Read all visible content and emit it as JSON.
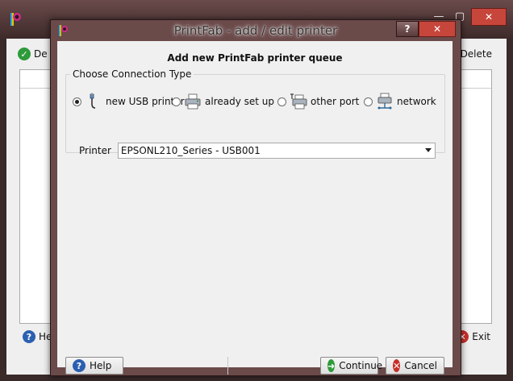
{
  "background_window": {
    "left_button_label": "De",
    "right_button_label": "Delete",
    "help_label": "He",
    "exit_label": "Exit",
    "close_glyph": "✕",
    "minimize_glyph": "—",
    "maximize_glyph": "▢"
  },
  "dialog": {
    "title": "PrintFab - add / edit printer",
    "help_glyph": "?",
    "close_glyph": "✕",
    "heading": "Add new PrintFab printer queue",
    "group_label": "Choose Connection Type",
    "connection_options": [
      {
        "label": "new USB printer",
        "icon": "usb-cable-icon",
        "checked": true
      },
      {
        "label": "already set up",
        "icon": "printer-icon",
        "checked": false
      },
      {
        "label": "other port",
        "icon": "tools-printer-icon",
        "checked": false
      },
      {
        "label": "network",
        "icon": "network-printer-icon",
        "checked": false
      }
    ],
    "printer_label": "Printer",
    "printer_value": "EPSONL210_Series - USB001",
    "help_button": "Help",
    "continue_button": "Continue",
    "cancel_button": "Cancel"
  },
  "colors": {
    "title_bar": "#6b4a4a",
    "close_button": "#c7463c",
    "dialog_body": "#f0f0f0"
  }
}
